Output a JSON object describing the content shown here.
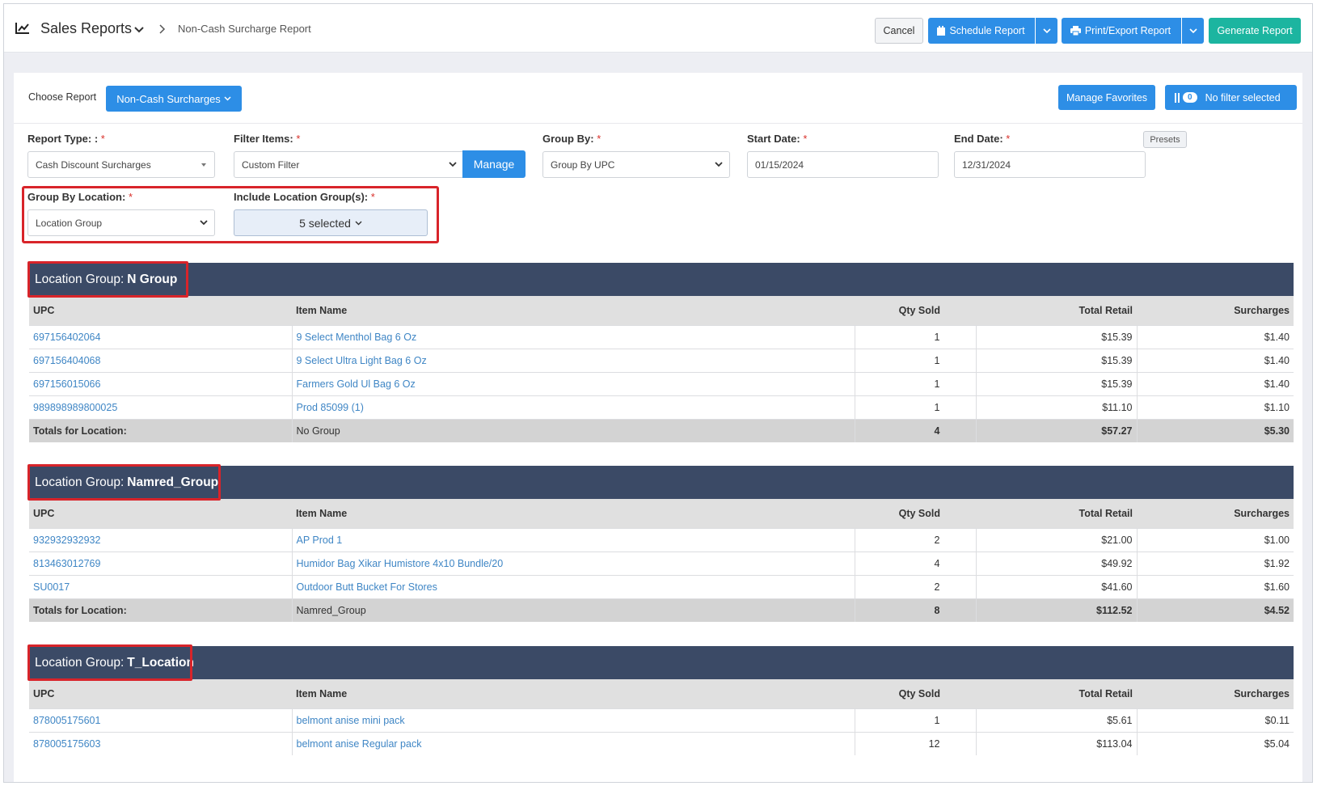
{
  "header": {
    "title": "Sales Reports",
    "breadcrumb": "Non-Cash Surcharge Report",
    "cancel_label": "Cancel",
    "schedule_label": "Schedule Report",
    "print_label": "Print/Export Report",
    "generate_label": "Generate Report"
  },
  "toolbar": {
    "choose_label": "Choose Report",
    "report_selected": "Non-Cash Surcharges",
    "manage_favorites": "Manage Favorites",
    "filter_count": "0",
    "filter_label": "No filter selected"
  },
  "filters": {
    "report_type_label": "Report Type: :",
    "report_type_value": "Cash Discount Surcharges",
    "filter_items_label": "Filter Items:",
    "filter_items_value": "Custom Filter",
    "manage_label": "Manage",
    "group_by_label": "Group By:",
    "group_by_value": "Group By UPC",
    "start_date_label": "Start Date:",
    "start_date_value": "01/15/2024",
    "end_date_label": "End Date:",
    "end_date_value": "12/31/2024",
    "presets_label": "Presets",
    "group_location_label": "Group By Location:",
    "group_location_value": "Location Group",
    "include_groups_label": "Include Location Group(s):",
    "include_groups_value": "5 selected",
    "required_mark": "*"
  },
  "columns": {
    "upc": "UPC",
    "name": "Item Name",
    "qty": "Qty Sold",
    "total": "Total Retail",
    "surcharges": "Surcharges"
  },
  "group_prefix": "Location Group:",
  "totals_label": "Totals for Location:",
  "groups": [
    {
      "name": "N  Group",
      "rows": [
        {
          "upc": "697156402064",
          "name": "9 Select Menthol Bag 6 Oz",
          "qty": "1",
          "total": "$15.39",
          "sur": "$1.40"
        },
        {
          "upc": "697156404068",
          "name": "9 Select Ultra Light Bag 6 Oz",
          "qty": "1",
          "total": "$15.39",
          "sur": "$1.40"
        },
        {
          "upc": "697156015066",
          "name": "Farmers Gold Ul Bag 6 Oz",
          "qty": "1",
          "total": "$15.39",
          "sur": "$1.40"
        },
        {
          "upc": "989898989800025",
          "name": "Prod 85099 (1)",
          "qty": "1",
          "total": "$11.10",
          "sur": "$1.10"
        }
      ],
      "totals": {
        "name": "No Group",
        "qty": "4",
        "total": "$57.27",
        "sur": "$5.30"
      }
    },
    {
      "name": "Namred_Group",
      "rows": [
        {
          "upc": "932932932932",
          "name": "AP Prod 1",
          "qty": "2",
          "total": "$21.00",
          "sur": "$1.00"
        },
        {
          "upc": "813463012769",
          "name": "Humidor Bag Xikar Humistore 4x10 Bundle/20",
          "qty": "4",
          "total": "$49.92",
          "sur": "$1.92"
        },
        {
          "upc": "SU0017",
          "name": "Outdoor Butt Bucket For Stores",
          "qty": "2",
          "total": "$41.60",
          "sur": "$1.60"
        }
      ],
      "totals": {
        "name": "Namred_Group",
        "qty": "8",
        "total": "$112.52",
        "sur": "$4.52"
      }
    },
    {
      "name": "T_Location",
      "rows": [
        {
          "upc": "878005175601",
          "name": "belmont anise mini pack",
          "qty": "1",
          "total": "$5.61",
          "sur": "$0.11"
        },
        {
          "upc": "878005175603",
          "name": "belmont anise Regular pack",
          "qty": "12",
          "total": "$113.04",
          "sur": "$5.04"
        }
      ]
    }
  ]
}
